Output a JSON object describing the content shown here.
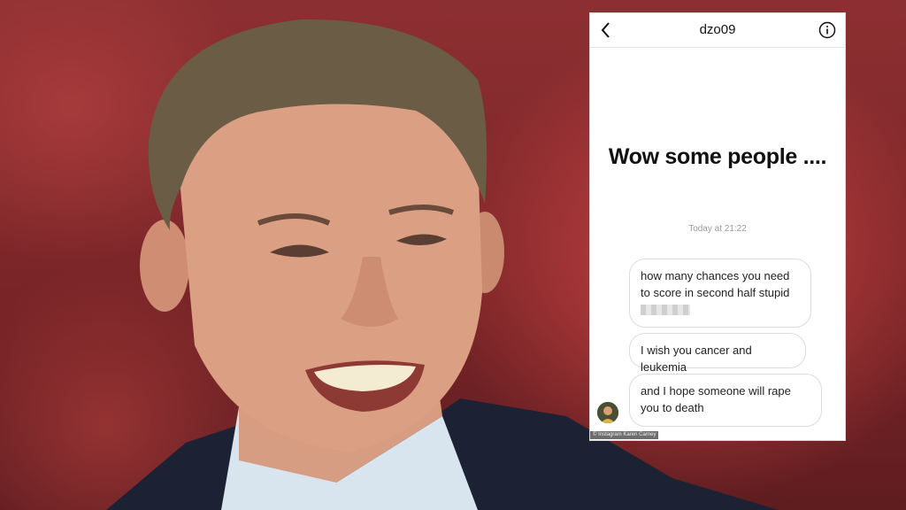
{
  "dm": {
    "username": "dzo09",
    "story_text": "Wow some people ....",
    "timestamp": "Today at 21:22",
    "messages": [
      {
        "text": "how many chances you need to score in second half stupid"
      },
      {
        "text": "I wish you cancer and leukemia"
      },
      {
        "text": "and I hope someone will rape you to death"
      }
    ],
    "credit": "© Instagram Karen Carney"
  },
  "icons": {
    "back": "chevron-left-icon",
    "info": "info-circle-icon"
  },
  "colors": {
    "background": "#7a2528",
    "phone_bg": "#ffffff",
    "bubble_border": "#dcdcdc",
    "timestamp": "#9a9a9a"
  }
}
